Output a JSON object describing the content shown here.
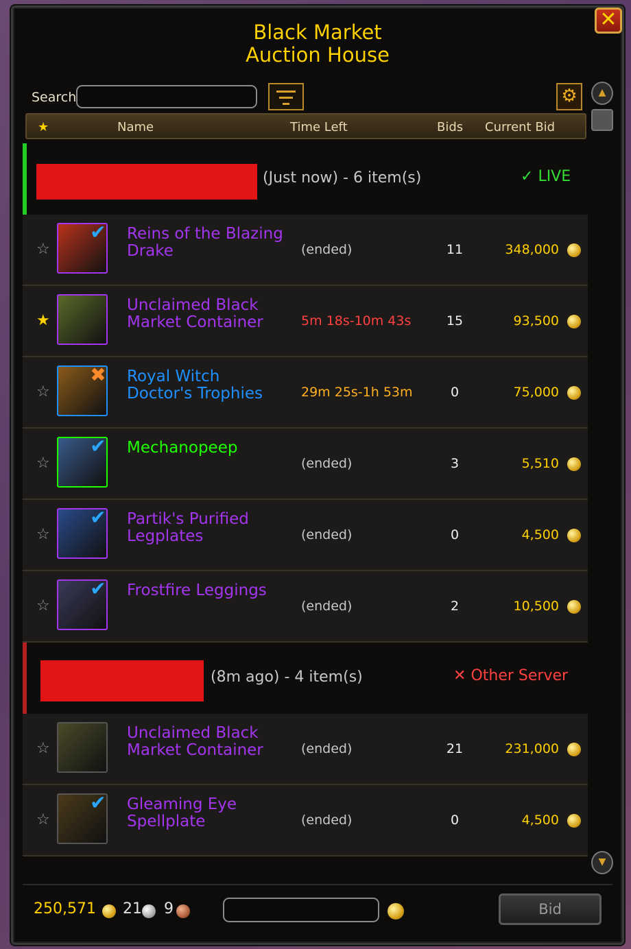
{
  "window": {
    "title_line1": "Black Market",
    "title_line2": "Auction House",
    "close_icon": "close-x-icon"
  },
  "search": {
    "label": "Search",
    "value": ""
  },
  "columns": {
    "fav": "★",
    "name": "Name",
    "time_left": "Time Left",
    "bids": "Bids",
    "current_bid": "Current Bid"
  },
  "groups": [
    {
      "info": "(Just now) - 6 item(s)",
      "status_glyph": "✓",
      "status": "LIVE",
      "status_color": "#33dd33",
      "bar_color": "#22cc22",
      "items": [
        {
          "fav": "☆",
          "fav_on": false,
          "name_line1": "Reins of the Blazing",
          "name_line2": "Drake",
          "name_color": "#a335ee",
          "time_left": "(ended)",
          "time_color": "#c8c8c8",
          "bids": "11",
          "current_bid": "348,000",
          "badge": "✔",
          "badge_type": "check",
          "icon_border": "#a335ee",
          "icon_bg": "#b8321c"
        },
        {
          "fav": "★",
          "fav_on": true,
          "name_line1": "Unclaimed Black",
          "name_line2": "Market Container",
          "name_color": "#a335ee",
          "time_left": "5m 18s-10m 43s",
          "time_color": "#ff4040",
          "bids": "15",
          "current_bid": "93,500",
          "badge": "",
          "badge_type": "",
          "icon_border": "#a335ee",
          "icon_bg": "#5a6a2a"
        },
        {
          "fav": "☆",
          "fav_on": false,
          "name_line1": "Royal Witch",
          "name_line2": "Doctor's Trophies",
          "name_color": "#1e90ff",
          "time_left": "29m 25s-1h 53m",
          "time_color": "#ffb020",
          "bids": "0",
          "current_bid": "75,000",
          "badge": "✖",
          "badge_type": "x",
          "icon_border": "#1e90ff",
          "icon_bg": "#8a5a1a"
        },
        {
          "fav": "☆",
          "fav_on": false,
          "name_line1": "Mechanopeep",
          "name_line2": "",
          "name_color": "#1eff00",
          "time_left": "(ended)",
          "time_color": "#c8c8c8",
          "bids": "3",
          "current_bid": "5,510",
          "badge": "✔",
          "badge_type": "check",
          "icon_border": "#1eff00",
          "icon_bg": "#3a5a8a"
        },
        {
          "fav": "☆",
          "fav_on": false,
          "name_line1": "Partik's Purified",
          "name_line2": "Legplates",
          "name_color": "#a335ee",
          "time_left": "(ended)",
          "time_color": "#c8c8c8",
          "bids": "0",
          "current_bid": "4,500",
          "badge": "✔",
          "badge_type": "check",
          "icon_border": "#a335ee",
          "icon_bg": "#2a4a8a"
        },
        {
          "fav": "☆",
          "fav_on": false,
          "name_line1": "Frostfire Leggings",
          "name_line2": "",
          "name_color": "#a335ee",
          "time_left": "(ended)",
          "time_color": "#c8c8c8",
          "bids": "2",
          "current_bid": "10,500",
          "badge": "✔",
          "badge_type": "check",
          "icon_border": "#a335ee",
          "icon_bg": "#3a3a5a"
        }
      ]
    },
    {
      "info": "(8m ago) - 4 item(s)",
      "status_glyph": "✕",
      "status": "Other Server",
      "status_color": "#ff4040",
      "bar_color": "#b02020",
      "items": [
        {
          "fav": "☆",
          "fav_on": false,
          "name_line1": "Unclaimed Black",
          "name_line2": "Market Container",
          "name_color": "#a335ee",
          "time_left": "(ended)",
          "time_color": "#c8c8c8",
          "bids": "21",
          "current_bid": "231,000",
          "badge": "",
          "badge_type": "",
          "icon_border": "#555555",
          "icon_bg": "#4a4a2a"
        },
        {
          "fav": "☆",
          "fav_on": false,
          "name_line1": "Gleaming Eye",
          "name_line2": "Spellplate",
          "name_color": "#a335ee",
          "time_left": "(ended)",
          "time_color": "#c8c8c8",
          "bids": "0",
          "current_bid": "4,500",
          "badge": "✔",
          "badge_type": "check",
          "icon_border": "#555555",
          "icon_bg": "#4a3a1a"
        }
      ]
    }
  ],
  "footer": {
    "gold": "250,571",
    "silver": "21",
    "copper": "9",
    "bid_value": "",
    "bid_button": "Bid"
  }
}
